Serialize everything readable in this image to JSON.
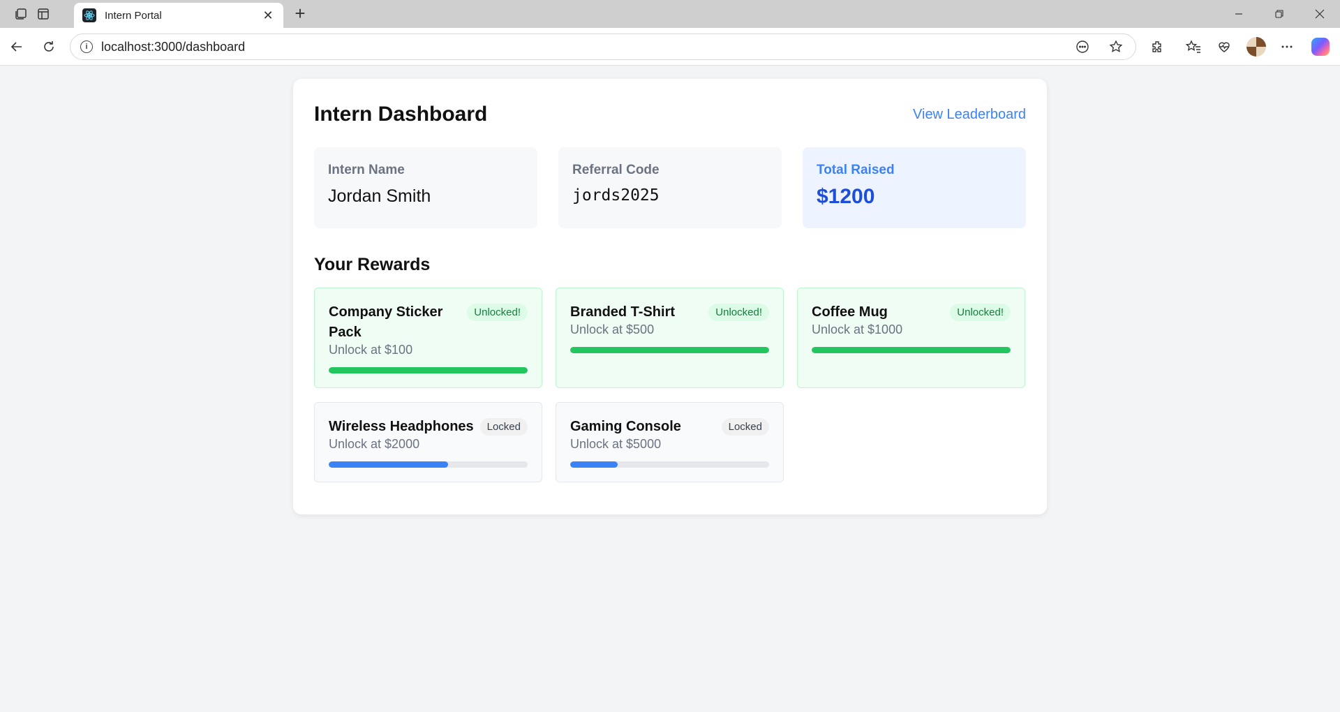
{
  "browser": {
    "tab_title": "Intern Portal",
    "url": "localhost:3000/dashboard"
  },
  "page": {
    "title": "Intern Dashboard",
    "leaderboard_link": "View Leaderboard",
    "stats": {
      "name_label": "Intern Name",
      "name_value": "Jordan Smith",
      "code_label": "Referral Code",
      "code_value": "jords2025",
      "total_label": "Total Raised",
      "total_value": "$1200"
    },
    "rewards_title": "Your Rewards",
    "rewards": [
      {
        "name": "Company Sticker Pack",
        "threshold": "Unlock at $100",
        "status": "Unlocked!",
        "progress": 1.0
      },
      {
        "name": "Branded T-Shirt",
        "threshold": "Unlock at $500",
        "status": "Unlocked!",
        "progress": 1.0
      },
      {
        "name": "Coffee Mug",
        "threshold": "Unlock at $1000",
        "status": "Unlocked!",
        "progress": 1.0
      },
      {
        "name": "Wireless Headphones",
        "threshold": "Unlock at $2000",
        "status": "Locked",
        "progress": 0.6
      },
      {
        "name": "Gaming Console",
        "threshold": "Unlock at $5000",
        "status": "Locked",
        "progress": 0.24
      }
    ]
  },
  "colors": {
    "accent": "#3b82f6",
    "unlocked_bar": "#22c55e",
    "locked_bar": "#3b82f6"
  }
}
